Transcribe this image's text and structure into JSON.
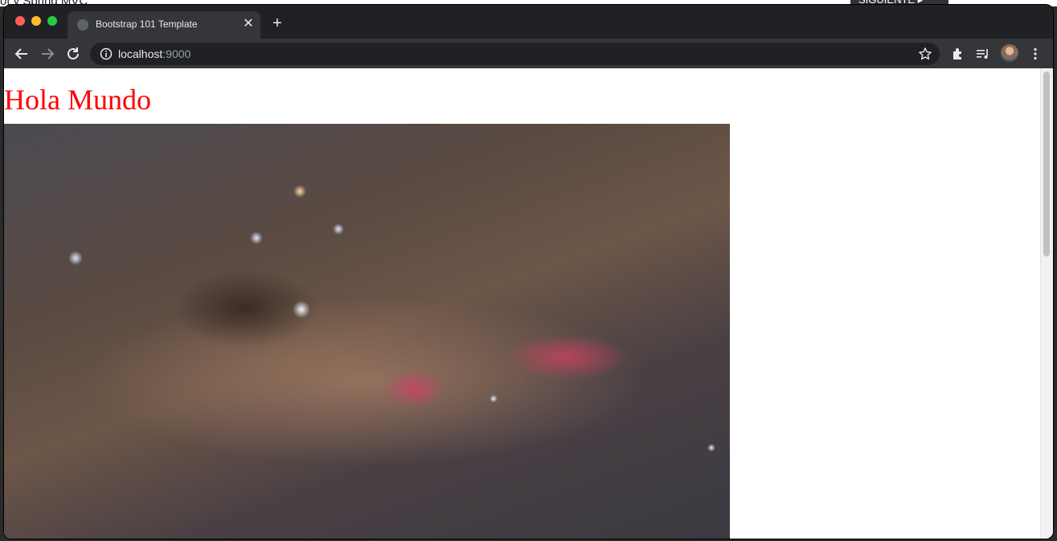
{
  "backdrop": {
    "heading_fragment": "ot y Spring MVC",
    "button_fragment": "SIGUIENTE ▸"
  },
  "browser": {
    "tab": {
      "title": "Bootstrap 101 Template",
      "favicon": "globe-icon"
    },
    "address": {
      "host": "localhost",
      "port": ":9000"
    },
    "icons": [
      "back-arrow-icon",
      "forward-arrow-icon",
      "reload-icon",
      "info-icon",
      "star-icon",
      "extensions-puzzle-icon",
      "media-queue-icon",
      "avatar",
      "more-vert-icon"
    ]
  },
  "page": {
    "heading": "Hola Mundo",
    "heading_color": "#ff0000",
    "image_subject": "milky-way-photo"
  }
}
